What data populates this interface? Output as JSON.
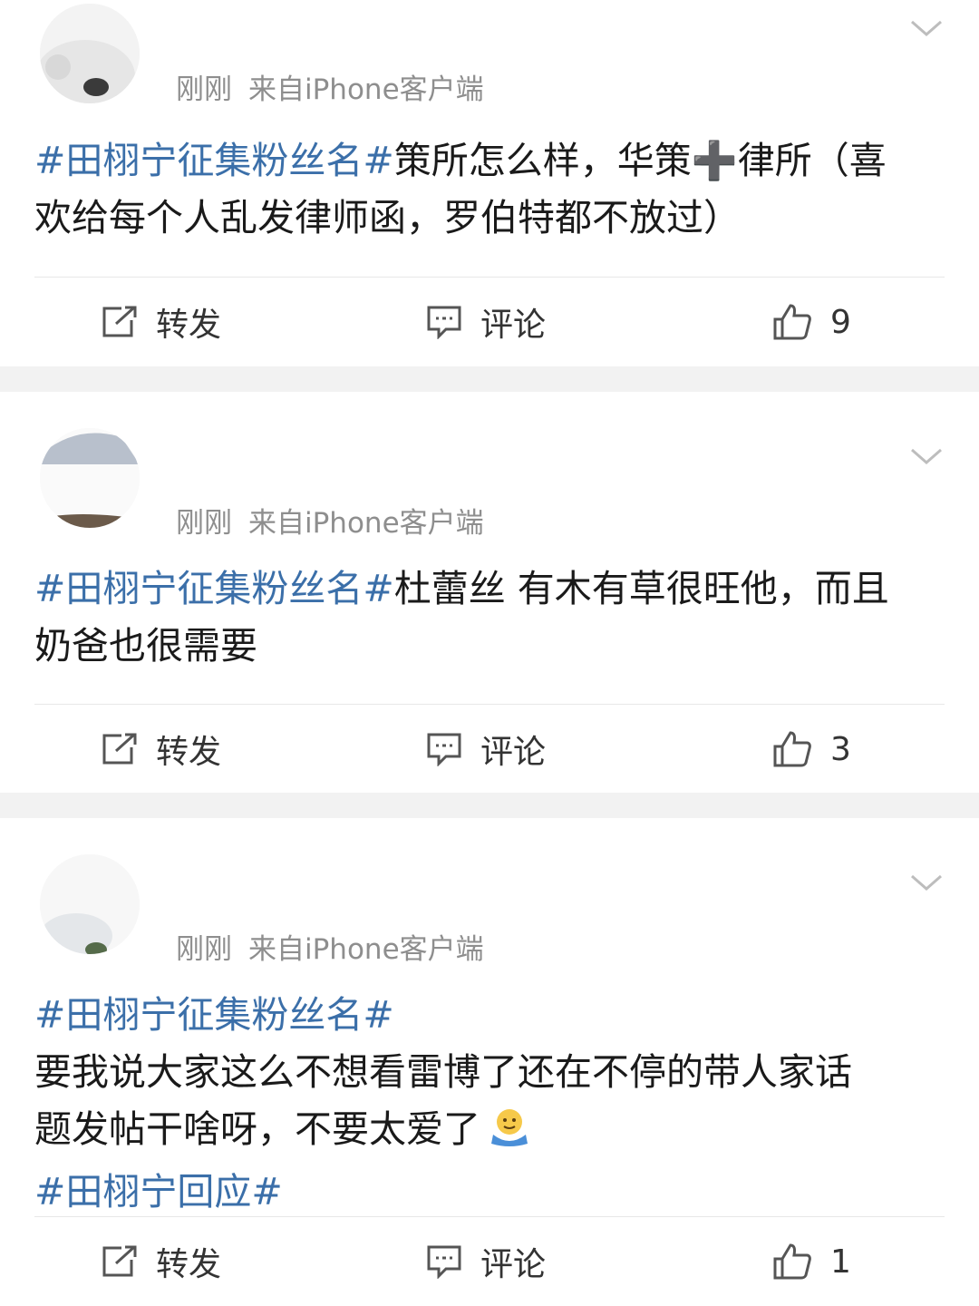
{
  "posts": [
    {
      "time": "刚刚",
      "source": "来自iPhone客户端",
      "lines": [
        [
          {
            "t": "#田栩宁征集粉丝名#",
            "tag": true
          },
          {
            "t": "策所怎么样，华策",
            "tag": false
          },
          {
            "t": "➕",
            "tag": false
          },
          {
            "t": "律所（喜",
            "tag": false
          }
        ],
        [
          {
            "t": "欢给每个人乱发律师函，罗伯特都不放过）",
            "tag": false
          }
        ]
      ],
      "repost_label": "转发",
      "comment_label": "评论",
      "likes": "9"
    },
    {
      "time": "刚刚",
      "source": "来自iPhone客户端",
      "lines": [
        [
          {
            "t": "#田栩宁征集粉丝名#",
            "tag": true
          },
          {
            "t": "杜蕾丝 有木有草很旺他，而且",
            "tag": false
          }
        ],
        [
          {
            "t": "奶爸也很需要",
            "tag": false
          }
        ]
      ],
      "repost_label": "转发",
      "comment_label": "评论",
      "likes": "3"
    },
    {
      "time": "刚刚",
      "source": "来自iPhone客户端",
      "lines": [
        [
          {
            "t": "#田栩宁征集粉丝名#",
            "tag": true
          }
        ],
        [
          {
            "t": "要我说大家这么不想看雷博了还在不停的带人家话",
            "tag": false
          }
        ],
        [
          {
            "t": "题发帖干啥呀，不要太爱了",
            "tag": false
          }
        ],
        [
          {
            "t": "#田栩宁回应#",
            "tag": true
          }
        ]
      ],
      "emoji_after_line": 2,
      "emoji": "hug-emoji",
      "repost_label": "转发",
      "comment_label": "评论",
      "likes": "1"
    }
  ],
  "colors": {
    "tag": "#3b6fa9",
    "meta": "#8e8e8e",
    "separator": "#f2f2f2"
  }
}
